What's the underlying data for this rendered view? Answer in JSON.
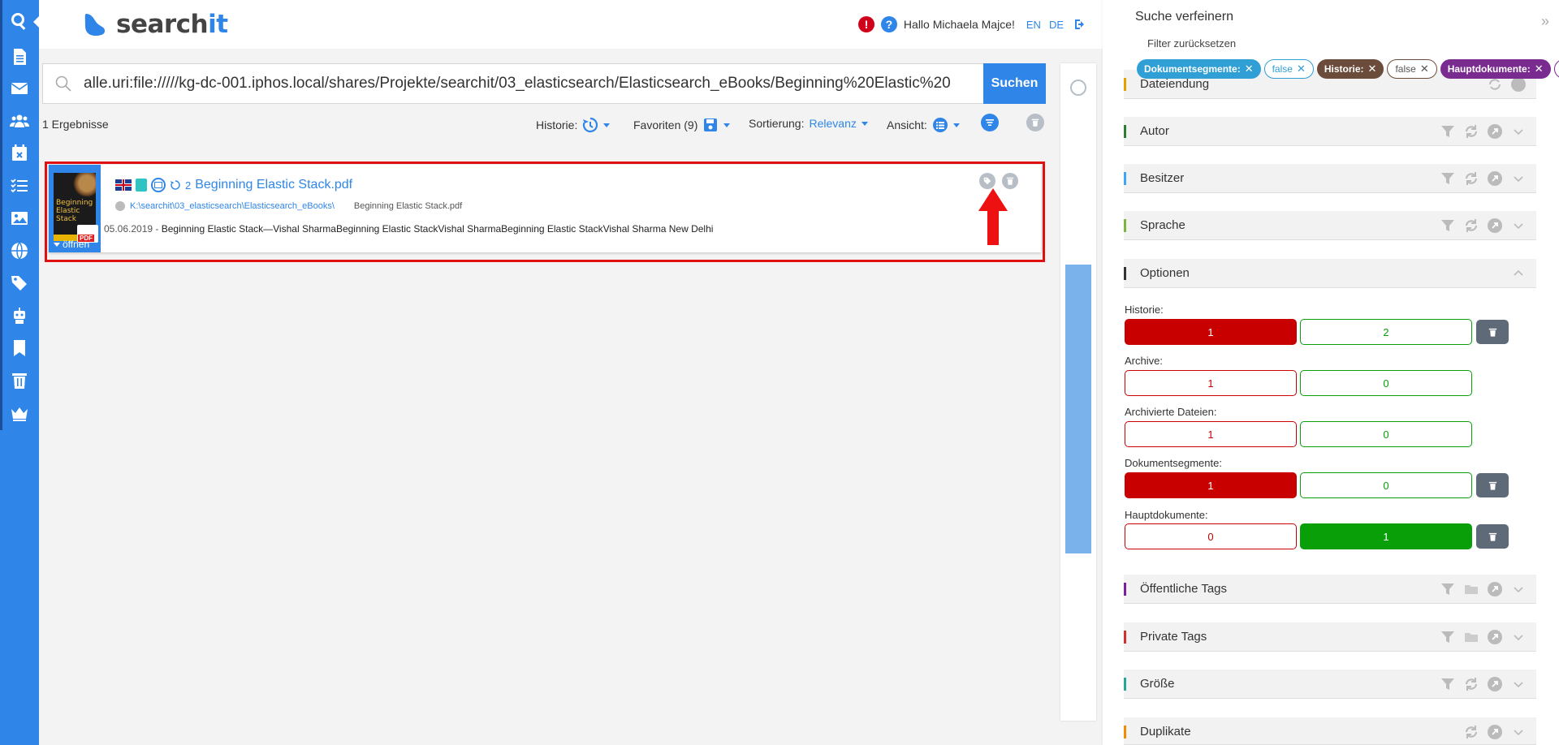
{
  "app": {
    "logo_text_main": "search",
    "logo_text_accent": "it"
  },
  "header": {
    "alert_symbol": "!",
    "help_symbol": "?",
    "greeting": "Hallo Michaela Majce!",
    "lang_en": "EN",
    "lang_de": "DE"
  },
  "leftbar": {
    "items": [
      "search-icon",
      "document-icon",
      "mail-icon",
      "users-icon",
      "calendar-icon",
      "tasks-icon",
      "image-icon",
      "globe-icon",
      "tags-icon",
      "robot-icon",
      "bookmark-icon",
      "trash-icon",
      "crown-icon"
    ]
  },
  "search": {
    "query": "alle.uri:file://///kg-dc-001.iphos.local/shares/Projekte/searchit/03_elasticsearch/Elasticsearch_eBooks/Beginning%20Elastic%20",
    "button": "Suchen"
  },
  "toolbar": {
    "results_count": "1 Ergebnisse",
    "history_label": "Historie:",
    "favorites_label": "Favoriten (9)",
    "sort_label": "Sortierung:",
    "sort_value": "Relevanz",
    "view_label": "Ansicht:"
  },
  "result": {
    "thumb_title": "Beginning Elastic Stack",
    "pdf_badge": "PDF",
    "open_label": "öffnen",
    "history_count": "2",
    "title": "Beginning Elastic Stack.pdf",
    "path": "K:\\searchit\\03_elasticsearch\\Elasticsearch_eBooks\\",
    "filename": "Beginning Elastic Stack.pdf",
    "date": "05.06.2019",
    "snippet_sep": " - ",
    "snippet": "Beginning Elastic Stack—Vishal SharmaBeginning Elastic StackVishal SharmaBeginning Elastic StackVishal Sharma New Delhi"
  },
  "panel": {
    "title": "Suche verfeinern",
    "collapse": "»",
    "reset": "Filter zurücksetzen",
    "chips": [
      {
        "text": "Dokumentsegmente:",
        "style": "filled",
        "color": "#2f9fd6"
      },
      {
        "text": "false",
        "style": "outline",
        "color": "#2f9fd6"
      },
      {
        "text": "Historie:",
        "style": "filled",
        "color": "#6b4c3b"
      },
      {
        "text": "false",
        "style": "outline",
        "color": "#6b4c3b"
      },
      {
        "text": "Hauptdokumente:",
        "style": "filled",
        "color": "#7a2b8f"
      },
      {
        "text": "true",
        "style": "outline",
        "color": "#7a2b8f"
      }
    ],
    "facets": {
      "dateiendung": {
        "label": "Dateiendung",
        "accent": "#e8a000"
      },
      "autor": {
        "label": "Autor",
        "accent": "#2e7d32"
      },
      "besitzer": {
        "label": "Besitzer",
        "accent": "#42a5f5"
      },
      "sprache": {
        "label": "Sprache",
        "accent": "#7cb342"
      },
      "optionen": {
        "label": "Optionen",
        "accent": "#333333"
      },
      "oeffentliche_tags": {
        "label": "Öffentliche Tags",
        "accent": "#7b1fa2"
      },
      "private_tags": {
        "label": "Private Tags",
        "accent": "#d32f2f"
      },
      "groesse": {
        "label": "Größe",
        "accent": "#26a69a"
      },
      "duplikate": {
        "label": "Duplikate",
        "accent": "#ef8c00"
      }
    },
    "options": {
      "historie": {
        "label": "Historie:",
        "left": "1",
        "right": "2"
      },
      "archive": {
        "label": "Archive:",
        "left": "1",
        "right": "0"
      },
      "archivierte": {
        "label": "Archivierte Dateien:",
        "left": "1",
        "right": "0"
      },
      "dokumentsegmente": {
        "label": "Dokumentsegmente:",
        "left": "1",
        "right": "0"
      },
      "hauptdokumente": {
        "label": "Hauptdokumente:",
        "left": "0",
        "right": "1"
      }
    }
  }
}
